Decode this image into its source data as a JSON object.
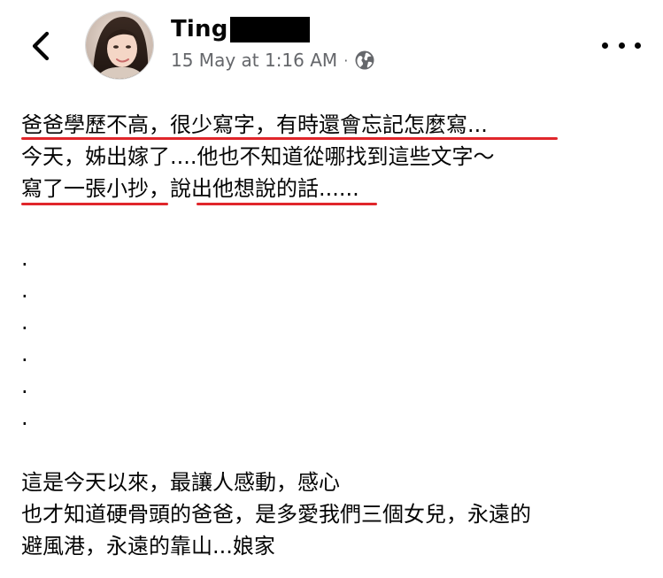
{
  "header": {
    "author_name": "Ting",
    "timestamp": "15 May at 1:16 AM",
    "separator": "·",
    "privacy_icon": "globe-icon",
    "back_icon": "chevron-left-icon",
    "more_icon": "more-options-icon"
  },
  "post": {
    "lines": [
      "爸爸學歷不高，很少寫字，有時還會忘記怎麼寫...",
      "今天，姊出嫁了....他也不知道從哪找到這些文字～",
      "寫了一張小抄，說出他想說的話......"
    ],
    "dots": [
      ".",
      ".",
      ".",
      ".",
      ".",
      "."
    ],
    "closing_lines": [
      "這是今天以來，最讓人感動，感心",
      "也才知道硬骨頭的爸爸，是多愛我們三個女兒，永遠的",
      "避風港，永遠的靠山...娘家"
    ]
  },
  "colors": {
    "underline": "#e0262b",
    "meta_text": "#65676b",
    "redaction": "#000000"
  }
}
